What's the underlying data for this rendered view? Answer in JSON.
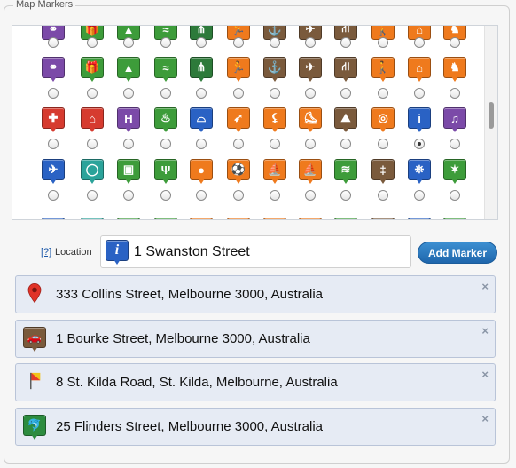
{
  "fieldset": {
    "legend": "Map Markers"
  },
  "picker": {
    "colors": {
      "purple": "#7b4aa8",
      "green": "#3d9c3a",
      "red": "#d63b2f",
      "blue": "#2a62c4",
      "orange": "#ef7a1d",
      "brown": "#7a5a3c",
      "yellow": "#f2a51d",
      "teal": "#2ba39a",
      "darkgreen": "#2d7a3a"
    },
    "rows": [
      {
        "icons": [
          {
            "name": "wedding-rings-icon",
            "color": "purple",
            "glyph": "⚭"
          },
          {
            "name": "gift-icon",
            "color": "green",
            "glyph": "🎁"
          },
          {
            "name": "mountains-icon",
            "color": "green",
            "glyph": "▲"
          },
          {
            "name": "swimming-icon",
            "color": "green",
            "glyph": "≈"
          },
          {
            "name": "grass-icon",
            "color": "darkgreen",
            "glyph": "⋔"
          },
          {
            "name": "running-icon",
            "color": "orange",
            "glyph": "🏃"
          },
          {
            "name": "anchor-icon",
            "color": "brown",
            "glyph": "⚓"
          },
          {
            "name": "helicopter-icon",
            "color": "brown",
            "glyph": "✈"
          },
          {
            "name": "highway-icon",
            "color": "brown",
            "glyph": "⛙"
          },
          {
            "name": "walking-icon",
            "color": "orange",
            "glyph": "🚶"
          },
          {
            "name": "home-icon",
            "color": "orange",
            "glyph": "⌂"
          },
          {
            "name": "horse-riding-icon",
            "color": "orange",
            "glyph": "♞"
          }
        ],
        "checked": -1
      },
      {
        "icons": [
          {
            "name": "hospital-icon",
            "color": "red",
            "glyph": "✚"
          },
          {
            "name": "cabin-icon",
            "color": "red",
            "glyph": "⌂"
          },
          {
            "name": "hotel-icon",
            "color": "purple",
            "glyph": "H"
          },
          {
            "name": "hot-springs-icon",
            "color": "green",
            "glyph": "♨"
          },
          {
            "name": "bridge-icon",
            "color": "blue",
            "glyph": "⌓"
          },
          {
            "name": "shooting-icon",
            "color": "orange",
            "glyph": "➹"
          },
          {
            "name": "hockey-icon",
            "color": "orange",
            "glyph": "⚸"
          },
          {
            "name": "skating-icon",
            "color": "orange",
            "glyph": "⛸"
          },
          {
            "name": "climbing-icon",
            "color": "brown",
            "glyph": "⛰"
          },
          {
            "name": "olympics-icon",
            "color": "orange",
            "glyph": "◎"
          },
          {
            "name": "info-icon",
            "color": "blue",
            "glyph": "i"
          },
          {
            "name": "music-icon",
            "color": "purple",
            "glyph": "♫"
          }
        ],
        "checked": 10
      },
      {
        "icons": [
          {
            "name": "airport-icon",
            "color": "blue",
            "glyph": "✈"
          },
          {
            "name": "ring-icon",
            "color": "teal",
            "glyph": "◯"
          },
          {
            "name": "map-sign-icon",
            "color": "green",
            "glyph": "▣"
          },
          {
            "name": "menorah-icon",
            "color": "green",
            "glyph": "Ψ"
          },
          {
            "name": "bowling-icon",
            "color": "orange",
            "glyph": "●"
          },
          {
            "name": "soccer-icon",
            "color": "orange",
            "glyph": "⚽"
          },
          {
            "name": "kayak-icon",
            "color": "orange",
            "glyph": "⛵"
          },
          {
            "name": "canoe-icon",
            "color": "orange",
            "glyph": "⛵"
          },
          {
            "name": "waterfall-icon",
            "color": "green",
            "glyph": "≋"
          },
          {
            "name": "fence-icon",
            "color": "brown",
            "glyph": "‡"
          },
          {
            "name": "lighthouse-icon",
            "color": "blue",
            "glyph": "⛯"
          },
          {
            "name": "lobster-icon",
            "color": "green",
            "glyph": "✶"
          }
        ],
        "checked": -1
      }
    ]
  },
  "location": {
    "help_link": "[?]",
    "label": "Location",
    "value": "1 Swanston Street",
    "marker_icon": "info-icon"
  },
  "add_button": {
    "label": "Add Marker"
  },
  "markers_list": [
    {
      "text": "333 Collins Street, Melbourne 3000, Australia",
      "icon": "red-pin-icon",
      "remove": "×"
    },
    {
      "text": "1 Bourke Street, Melbourne 3000, Australia",
      "icon": "car-icon",
      "remove": "×"
    },
    {
      "text": "8 St. Kilda Road, St. Kilda, Melbourne, Australia",
      "icon": "flag-icon",
      "remove": "×"
    },
    {
      "text": "25 Flinders Street, Melbourne 3000, Australia",
      "icon": "dolphin-icon",
      "remove": "×"
    }
  ]
}
